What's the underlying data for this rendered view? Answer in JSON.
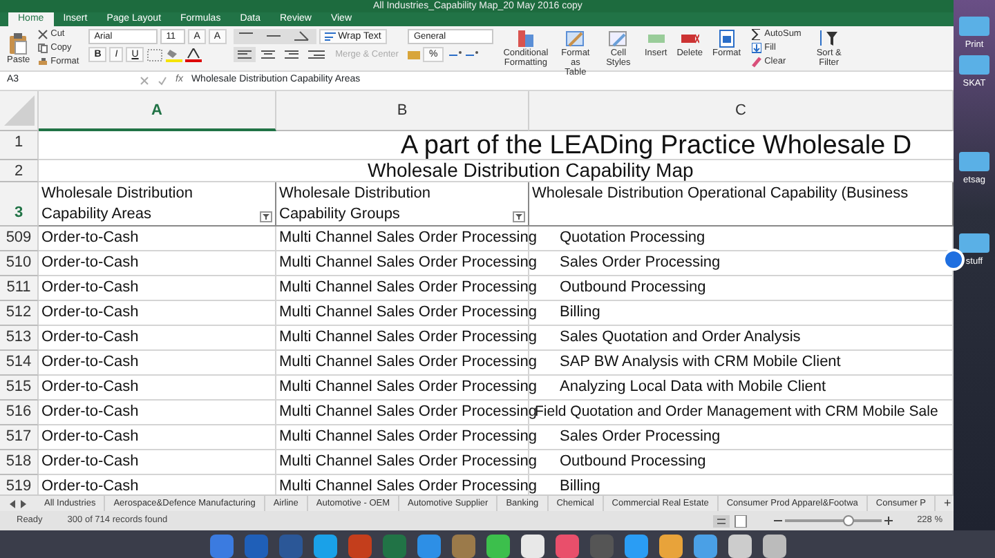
{
  "window": {
    "title": "All Industries_Capability Map_20 May 2016 copy"
  },
  "ribbon_tabs": [
    {
      "label": "Home",
      "selected": true
    },
    {
      "label": "Insert",
      "selected": false
    },
    {
      "label": "Page Layout",
      "selected": false
    },
    {
      "label": "Formulas",
      "selected": false
    },
    {
      "label": "Data",
      "selected": false
    },
    {
      "label": "Review",
      "selected": false
    },
    {
      "label": "View",
      "selected": false
    }
  ],
  "ribbon": {
    "paste": "Paste",
    "clipboard_items": [
      "Cut",
      "Copy",
      "Format"
    ],
    "font_name": "Arial",
    "font_size": "11",
    "grow_buttons": [
      "A",
      "A"
    ],
    "style_buttons": [
      "B",
      "I",
      "U"
    ],
    "wrap_text": "Wrap Text",
    "merge": {
      "label": "Merge & Center",
      "disabled": true
    },
    "number_format": "General",
    "number_buttons": [
      "%"
    ],
    "styles": [
      "Conditional Formatting",
      "Format as Table",
      "Cell Styles"
    ],
    "cells": [
      "Insert",
      "Delete",
      "Format"
    ],
    "editing": [
      "AutoSum",
      "Fill",
      "Clear"
    ],
    "sort": "Sort & Filter"
  },
  "formula_bar": {
    "cell": "A3",
    "fx": "fx",
    "content": "Wholesale Distribution Capability Areas"
  },
  "columns": [
    "A",
    "B",
    "C"
  ],
  "title_rows": [
    {
      "number": "1",
      "text": "A part of the LEADing Practice Wholesale D"
    },
    {
      "number": "2",
      "text": "Wholesale Distribution Capability Map"
    }
  ],
  "header_row": {
    "number": "3",
    "cells": [
      "Wholesale Distribution Capability Areas",
      "Wholesale Distribution Capability Groups",
      "Wholesale Distribution Operational Capability (Business"
    ]
  },
  "rows": [
    {
      "number": "509",
      "cells": [
        "Order-to-Cash",
        "Multi Channel Sales Order Processing",
        "Quotation Processing"
      ]
    },
    {
      "number": "510",
      "cells": [
        "Order-to-Cash",
        "Multi Channel Sales Order Processing",
        "Sales Order Processing"
      ]
    },
    {
      "number": "511",
      "cells": [
        "Order-to-Cash",
        "Multi Channel Sales Order Processing",
        "Outbound Processing"
      ]
    },
    {
      "number": "512",
      "cells": [
        "Order-to-Cash",
        "Multi Channel Sales Order Processing",
        "Billing"
      ]
    },
    {
      "number": "513",
      "cells": [
        "Order-to-Cash",
        "Multi Channel Sales Order Processing",
        "Sales Quotation and Order Analysis"
      ]
    },
    {
      "number": "514",
      "cells": [
        "Order-to-Cash",
        "Multi Channel Sales Order Processing",
        "SAP BW Analysis with CRM Mobile Client"
      ]
    },
    {
      "number": "515",
      "cells": [
        "Order-to-Cash",
        "Multi Channel Sales Order Processing",
        "Analyzing Local Data with Mobile Client"
      ]
    },
    {
      "number": "516",
      "cells": [
        "Order-to-Cash",
        "Multi Channel Sales Order Processing",
        "Field Quotation and Order Management with CRM Mobile Sale"
      ]
    },
    {
      "number": "517",
      "cells": [
        "Order-to-Cash",
        "Multi Channel Sales Order Processing",
        "Sales Order Processing"
      ]
    },
    {
      "number": "518",
      "cells": [
        "Order-to-Cash",
        "Multi Channel Sales Order Processing",
        "Outbound Processing"
      ]
    },
    {
      "number": "519",
      "cells": [
        "Order-to-Cash",
        "Multi Channel Sales Order Processing",
        "Billing"
      ]
    }
  ],
  "sheet_tabs": [
    {
      "label": "All Industries",
      "selected": false
    },
    {
      "label": "Aerospace&Defence Manufacturing",
      "selected": false
    },
    {
      "label": "Airline",
      "selected": false
    },
    {
      "label": "Automotive - OEM",
      "selected": false
    },
    {
      "label": "Automotive Supplier",
      "selected": false
    },
    {
      "label": "Banking",
      "selected": false
    },
    {
      "label": "Chemical",
      "selected": false
    },
    {
      "label": "Commercial Real Estate",
      "selected": false
    },
    {
      "label": "Consumer Prod Apparel&Footwa",
      "selected": false
    },
    {
      "label": "Consumer P",
      "selected": false
    }
  ],
  "add_sheet": "+",
  "status_bar": {
    "state": "Ready",
    "records": "300 of 714 records found",
    "zoom": "228 %",
    "zoom_slider": {
      "level": 0.66
    }
  },
  "desktop_labels": [
    "Print",
    "SKAT",
    "etsag",
    "stuff"
  ]
}
